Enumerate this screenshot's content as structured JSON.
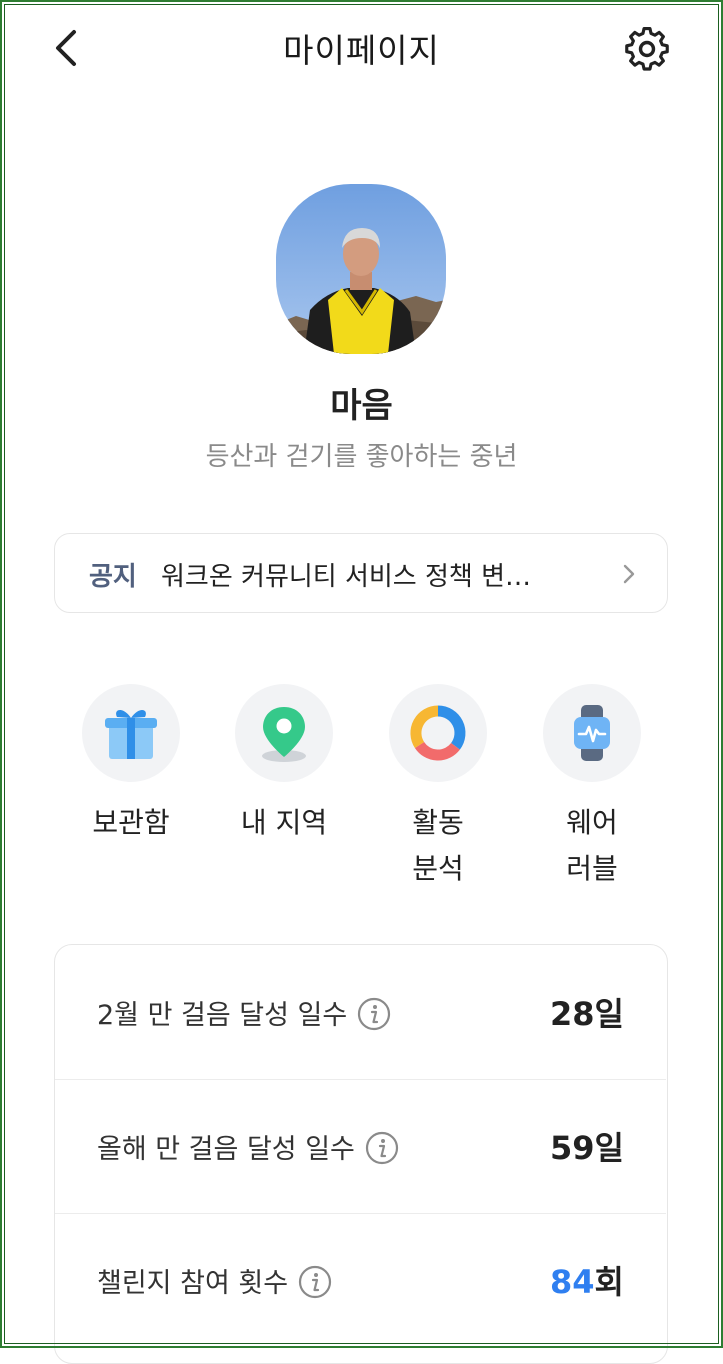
{
  "header": {
    "title": "마이페이지",
    "back_icon": "chevron-left-icon",
    "settings_icon": "gear-icon"
  },
  "profile": {
    "name": "마음",
    "bio": "등산과 걷기를 좋아하는 중년"
  },
  "notice": {
    "tag": "공지",
    "text": "워크온 커뮤니티 서비스 정책 변…"
  },
  "menu": [
    {
      "label": "보관함",
      "icon": "gift-icon"
    },
    {
      "label": "내 지역",
      "icon": "location-pin-icon"
    },
    {
      "label": "활동 분석",
      "icon": "donut-chart-icon"
    },
    {
      "label": "웨어 러블",
      "icon": "smartwatch-icon"
    }
  ],
  "stats": [
    {
      "label": "2월 만 걸음 달성 일수",
      "value": "28",
      "unit": "일"
    },
    {
      "label": "올해 만 걸음 달성 일수",
      "value": "59",
      "unit": "일"
    },
    {
      "label": "챌린지 참여 횟수",
      "value": "84",
      "unit": "회"
    }
  ],
  "colors": {
    "notice_tag": "#51607e",
    "accent_blue": "#2f7ff0",
    "frame": "#2e7d32"
  }
}
